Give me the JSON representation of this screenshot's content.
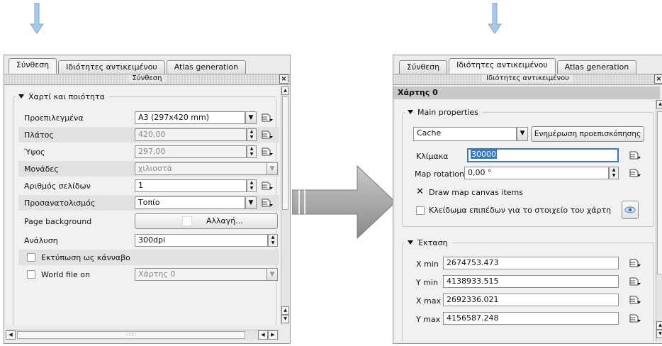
{
  "left": {
    "tabs": [
      "Σύνθεση",
      "Ιδιότητες αντικειμένου",
      "Atlas generation"
    ],
    "dock_title": "Σύνθεση",
    "close_glyph": "×",
    "group_title": "Χαρτί και ποιότητα",
    "presets_label": "Προεπιλεγμένα",
    "presets_value": "A3 (297x420 mm)",
    "width_label": "Πλάτος",
    "width_value": "420,00",
    "height_label": "Ύψος",
    "height_value": "297,00",
    "units_label": "Μονάδες",
    "units_value": "χιλιοστά",
    "pages_label": "Αριθμός σελίδων",
    "pages_value": "1",
    "orientation_label": "Προσανατολισμός",
    "orientation_value": "Τοπίο",
    "background_label": "Page background",
    "background_button": "Αλλαγή...",
    "resolution_label": "Ανάλυση",
    "resolution_value": "300dpi",
    "raster_label": "Εκτύπωση ως κάνναβο",
    "world_file_label": "World file on",
    "world_file_value": "Χάρτης 0",
    "scroll_grip": "∷∷∷"
  },
  "right": {
    "tabs": [
      "Σύνθεση",
      "Ιδιότητες αντικειμένου",
      "Atlas generation"
    ],
    "dock_title": "Ιδιότητες αντικειμένου",
    "item_title": "Χάρτης 0",
    "main_group": "Main properties",
    "cache_value": "Cache",
    "update_preview_button": "Ενημέρωση προεπισκόπησης",
    "scale_label": "Κλίμακα",
    "scale_value": "30000",
    "rotation_label": "Map rotation",
    "rotation_value": "0,00 °",
    "draw_items_label": "Draw map canvas items",
    "draw_items_mark": "✕",
    "lock_layers_label": "Κλείδωμα επιπέδων για το στοιχείο του χάρτη",
    "extent_group": "Έκταση",
    "xmin_label": "X min",
    "xmin_value": "2674753.473",
    "ymin_label": "Y min",
    "ymin_value": "4138933.515",
    "xmax_label": "X max",
    "xmax_value": "2692336.021",
    "ymax_label": "Y max",
    "ymax_value": "4156587.248"
  },
  "glyphs": {
    "dropdown": "▼",
    "spin_up": "▲",
    "spin_down": "▼",
    "scroll_left": "◀",
    "scroll_right": "▶"
  },
  "colors": {
    "arrow_blue": "#a9c9e8",
    "arrow_gray": "#9a9a9a",
    "highlight": "#3a78c8",
    "item_header": "#c8c8c8"
  }
}
